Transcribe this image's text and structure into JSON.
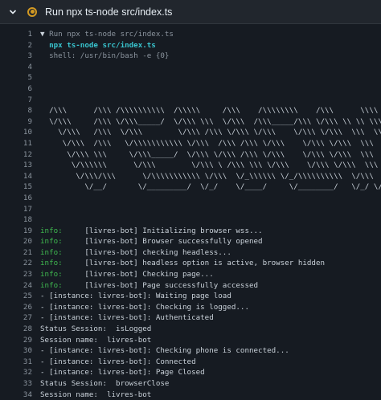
{
  "header": {
    "title": "Run npx ts-node src/index.ts"
  },
  "lines": [
    {
      "n": "1",
      "parts": [
        {
          "c": "tri",
          "t": "▼ "
        },
        {
          "c": "dim",
          "t": "Run npx ts-node src/index.ts"
        }
      ]
    },
    {
      "n": "2",
      "parts": [
        {
          "c": "cyan",
          "t": "  npx ts-node src/index.ts"
        }
      ]
    },
    {
      "n": "3",
      "parts": [
        {
          "c": "dim",
          "t": "  shell: /usr/bin/bash -e {0}"
        }
      ]
    },
    {
      "n": "4",
      "parts": []
    },
    {
      "n": "5",
      "parts": []
    },
    {
      "n": "6",
      "parts": []
    },
    {
      "n": "7",
      "parts": []
    },
    {
      "n": "8",
      "parts": [
        {
          "c": "txt",
          "t": "  /\\\\\\      /\\\\\\ /\\\\\\\\\\\\\\\\\\\\  /\\\\\\\\\\     /\\\\\\    /\\\\\\\\\\\\\\\\    /\\\\\\      \\\\\\\\"
        }
      ]
    },
    {
      "n": "9",
      "parts": [
        {
          "c": "txt",
          "t": "  \\/\\\\\\     /\\\\\\ \\/\\\\\\_____/  \\/\\\\\\ \\\\\\  \\/\\\\\\  /\\\\\\_____/\\\\\\ \\/\\\\\\ \\\\ \\\\ \\\\\\"
        }
      ]
    },
    {
      "n": "10",
      "parts": [
        {
          "c": "txt",
          "t": "    \\/\\\\\\   /\\\\\\  \\/\\\\\\        \\/\\\\\\ /\\\\\\ \\/\\\\\\ \\/\\\\\\    \\/\\\\\\ \\/\\\\\\  \\\\\\  \\\\\\"
        }
      ]
    },
    {
      "n": "11",
      "parts": [
        {
          "c": "txt",
          "t": "     \\/\\\\\\  /\\\\\\   \\/\\\\\\\\\\\\\\\\\\\\\\ \\/\\\\\\  /\\\\\\ /\\\\\\ \\/\\\\\\    \\/\\\\\\ \\/\\\\\\  \\\\\\  \\\\\\"
        }
      ]
    },
    {
      "n": "12",
      "parts": [
        {
          "c": "txt",
          "t": "      \\/\\\\\\ \\\\\\     \\/\\\\\\_____/  \\/\\\\\\ \\/\\\\\\ /\\\\\\ \\/\\\\\\    \\/\\\\\\ \\/\\\\\\  \\\\\\  \\\\\\"
        }
      ]
    },
    {
      "n": "13",
      "parts": [
        {
          "c": "txt",
          "t": "       \\/\\\\\\\\\\\\      \\/\\\\\\        \\/\\\\\\ \\ /\\\\\\ \\\\\\ \\/\\\\\\    \\/\\\\\\ \\/\\\\\\  \\\\\\  \\\\\\"
        }
      ]
    },
    {
      "n": "14",
      "parts": [
        {
          "c": "txt",
          "t": "        \\/\\\\\\/\\\\\\      \\/\\\\\\\\\\\\\\\\\\\\\\ \\/\\\\\\  \\/_\\\\\\\\\\\\ \\/_/\\\\\\\\\\\\\\\\\\\\  \\/\\\\\\  \\\\\\  \\\\\\"
        }
      ]
    },
    {
      "n": "15",
      "parts": [
        {
          "c": "txt",
          "t": "          \\/__/       \\/_________/  \\/_/    \\/____/     \\/________/   \\/_/ \\/_/ \\/_/"
        }
      ]
    },
    {
      "n": "16",
      "parts": []
    },
    {
      "n": "17",
      "parts": []
    },
    {
      "n": "18",
      "parts": []
    },
    {
      "n": "19",
      "parts": [
        {
          "c": "info",
          "t": "info:"
        },
        {
          "c": "txt",
          "t": "     [livres-bot] Initializing browser wss..."
        }
      ]
    },
    {
      "n": "20",
      "parts": [
        {
          "c": "info",
          "t": "info:"
        },
        {
          "c": "txt",
          "t": "     [livres-bot] Browser successfully opened"
        }
      ]
    },
    {
      "n": "21",
      "parts": [
        {
          "c": "info",
          "t": "info:"
        },
        {
          "c": "txt",
          "t": "     [livres-bot] checking headless..."
        }
      ]
    },
    {
      "n": "22",
      "parts": [
        {
          "c": "info",
          "t": "info:"
        },
        {
          "c": "txt",
          "t": "     [livres-bot] headless option is active, browser hidden"
        }
      ]
    },
    {
      "n": "23",
      "parts": [
        {
          "c": "info",
          "t": "info:"
        },
        {
          "c": "txt",
          "t": "     [livres-bot] Checking page..."
        }
      ]
    },
    {
      "n": "24",
      "parts": [
        {
          "c": "info",
          "t": "info:"
        },
        {
          "c": "txt",
          "t": "     [livres-bot] Page successfully accessed"
        }
      ]
    },
    {
      "n": "25",
      "parts": [
        {
          "c": "txt",
          "t": "- [instance: livres-bot]: Waiting page load"
        }
      ]
    },
    {
      "n": "26",
      "parts": [
        {
          "c": "txt",
          "t": "- [instance: livres-bot]: Checking is logged..."
        }
      ]
    },
    {
      "n": "27",
      "parts": [
        {
          "c": "txt",
          "t": "- [instance: livres-bot]: Authenticated"
        }
      ]
    },
    {
      "n": "28",
      "parts": [
        {
          "c": "txt",
          "t": "Status Session:  isLogged"
        }
      ]
    },
    {
      "n": "29",
      "parts": [
        {
          "c": "txt",
          "t": "Session name:  livres-bot"
        }
      ]
    },
    {
      "n": "30",
      "parts": [
        {
          "c": "txt",
          "t": "- [instance: livres-bot]: Checking phone is connected..."
        }
      ]
    },
    {
      "n": "31",
      "parts": [
        {
          "c": "txt",
          "t": "- [instance: livres-bot]: Connected"
        }
      ]
    },
    {
      "n": "32",
      "parts": [
        {
          "c": "txt",
          "t": "- [instance: livres-bot]: Page Closed"
        }
      ]
    },
    {
      "n": "33",
      "parts": [
        {
          "c": "txt",
          "t": "Status Session:  browserClose"
        }
      ]
    },
    {
      "n": "34",
      "parts": [
        {
          "c": "txt",
          "t": "Session name:  livres-bot"
        }
      ]
    }
  ]
}
